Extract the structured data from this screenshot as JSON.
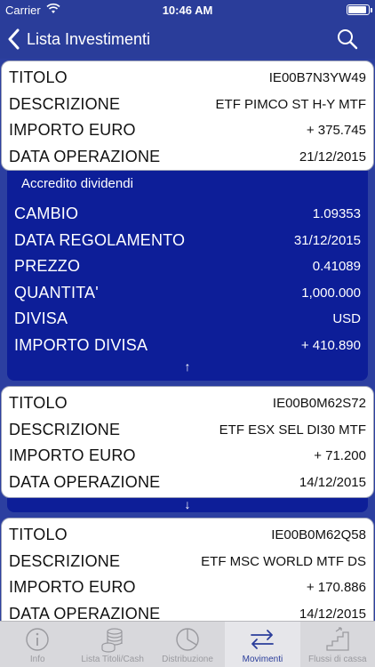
{
  "status_bar": {
    "carrier": "Carrier",
    "time": "10:46 AM"
  },
  "nav": {
    "back_label": "Lista Investimenti"
  },
  "cards": [
    {
      "rows": [
        {
          "label": "TITOLO",
          "value": "IE00B7N3YW49"
        },
        {
          "label": "DESCRIZIONE",
          "value": "ETF PIMCO ST H-Y MTF"
        },
        {
          "label": "IMPORTO EURO",
          "value": "+ 375.745"
        },
        {
          "label": "DATA OPERAZIONE",
          "value": "21/12/2015"
        }
      ]
    },
    {
      "rows": [
        {
          "label": "TITOLO",
          "value": "IE00B0M62S72"
        },
        {
          "label": "DESCRIZIONE",
          "value": "ETF ESX SEL DI30 MTF"
        },
        {
          "label": "IMPORTO EURO",
          "value": "+ 71.200"
        },
        {
          "label": "DATA OPERAZIONE",
          "value": "14/12/2015"
        }
      ]
    },
    {
      "rows": [
        {
          "label": "TITOLO",
          "value": "IE00B0M62Q58"
        },
        {
          "label": "DESCRIZIONE",
          "value": "ETF MSC WORLD MTF DS"
        },
        {
          "label": "IMPORTO EURO",
          "value": "+ 170.886"
        },
        {
          "label": "DATA OPERAZIONE",
          "value": "14/12/2015"
        }
      ]
    }
  ],
  "detail": {
    "subtitle": "Accredito dividendi",
    "rows": [
      {
        "label": "CAMBIO",
        "value": "1.09353"
      },
      {
        "label": "DATA REGOLAMENTO",
        "value": "31/12/2015"
      },
      {
        "label": "PREZZO",
        "value": "0.41089"
      },
      {
        "label": "QUANTITA'",
        "value": "1,000.000"
      },
      {
        "label": "DIVISA",
        "value": "USD"
      },
      {
        "label": "IMPORTO DIVISA",
        "value": "+ 410.890"
      }
    ],
    "collapse_arrow": "↑"
  },
  "expand_arrow": "↓",
  "tabs": [
    {
      "label": "Info",
      "icon": "info-icon",
      "active": false
    },
    {
      "label": "Lista Titoli/Cash",
      "icon": "coins-icon",
      "active": false
    },
    {
      "label": "Distribuzione",
      "icon": "pie-icon",
      "active": false
    },
    {
      "label": "Movimenti",
      "icon": "transfer-arrows-icon",
      "active": true
    },
    {
      "label": "Flussi di cassa",
      "icon": "stairs-icon",
      "active": false
    }
  ],
  "colors": {
    "brand": "#2a3d9a",
    "detail_bg": "#0d1e98",
    "tab_active": "#2a3d9a",
    "tab_inactive": "#9a9a9f"
  }
}
